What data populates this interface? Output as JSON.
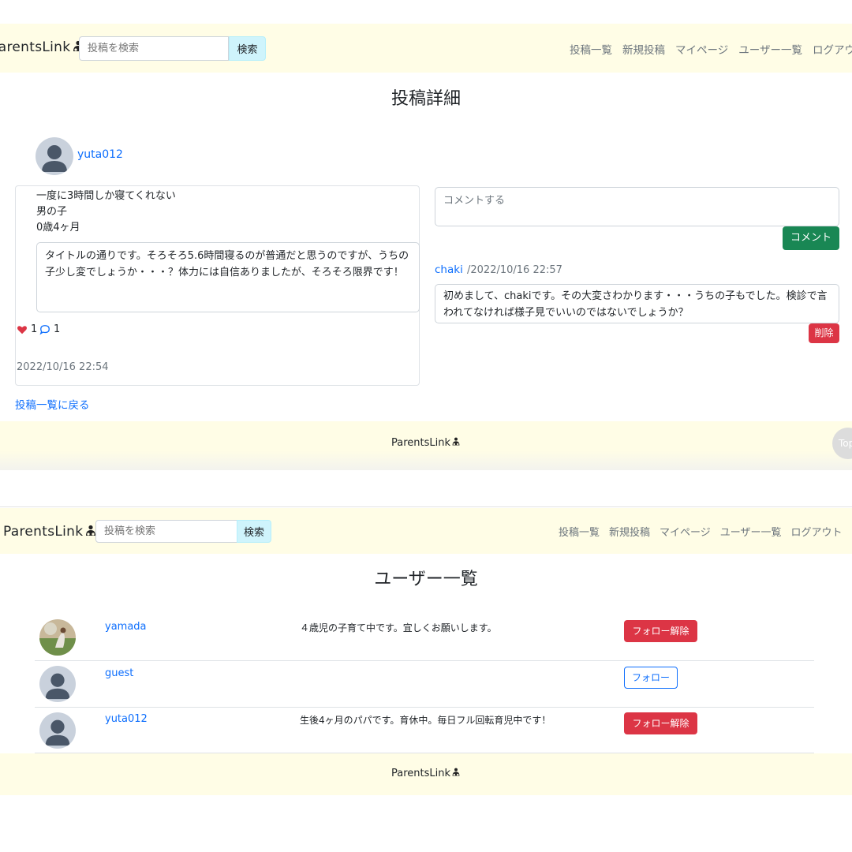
{
  "screen1": {
    "brand": "ParentsLink",
    "search_placeholder": "投稿を検索",
    "search_button": "検索",
    "nav": [
      "投稿一覧",
      "新規投稿",
      "マイページ",
      "ユーザー一覧",
      "ログアウト"
    ],
    "page_title": "投稿詳細",
    "post": {
      "author": "yuta012",
      "title_lines": [
        "一度に3時間しか寝てくれない",
        "男の子",
        "0歳4ヶ月"
      ],
      "body": "タイトルの通りです。そろそろ5.6時間寝るのが普通だと思うのですが、うちの子少し変でしょうか・・・？体力には自信ありましたが、そろそろ限界です！",
      "likes": "1",
      "comments_count": "1",
      "timestamp": "2022/10/16 22:54"
    },
    "comment_placeholder": "コメントする",
    "comment_button": "コメント",
    "comment": {
      "author": "chaki",
      "date": "/2022/10/16 22:57",
      "body": "初めまして、chakiです。その大変さわかります・・・うちの子もでした。検診で言われてなければ様子見でいいのではないでしょうか？",
      "delete_button": "削除"
    },
    "back_link": "投稿一覧に戻る",
    "footer_brand": "ParentsLink",
    "top_button": "Top"
  },
  "screen2": {
    "brand": "ParentsLink",
    "search_placeholder": "投稿を検索",
    "search_button": "検索",
    "nav": [
      "投稿一覧",
      "新規投稿",
      "マイページ",
      "ユーザー一覧",
      "ログアウト"
    ],
    "page_title": "ユーザー一覧",
    "users": [
      {
        "name": "yamada",
        "bio": "４歳児の子育て中です。宜しくお願いします。",
        "action": "フォロー解除"
      },
      {
        "name": "guest",
        "bio": "",
        "action": "フォロー"
      },
      {
        "name": "yuta012",
        "bio": "生後4ヶ月のパパです。育休中。毎日フル回転育児中です！",
        "action": "フォロー解除"
      }
    ],
    "footer_brand": "ParentsLink"
  },
  "colors": {
    "navbar_bg": "#fffde6",
    "link": "#0d6efd",
    "danger": "#dc3545",
    "success": "#198754",
    "search_btn": "#cff4fc"
  }
}
